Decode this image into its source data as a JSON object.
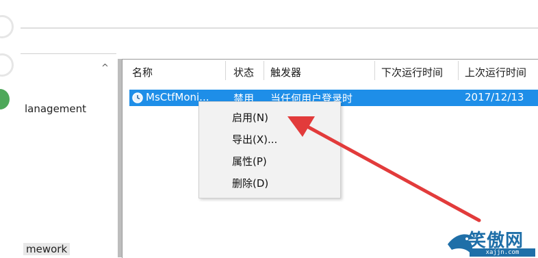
{
  "left_tree": {
    "items": [
      "lanagement",
      "mework"
    ]
  },
  "columns": [
    "名称",
    "状态",
    "触发器",
    "下次运行时间",
    "上次运行时间"
  ],
  "task": {
    "name": "MsCtfMoni...",
    "status": "禁用",
    "trigger": "当任何用户登录时",
    "next_run": "",
    "last_run": "2017/12/13"
  },
  "context_menu": {
    "items": [
      "启用(N)",
      "导出(X)...",
      "属性(P)",
      "删除(D)"
    ]
  },
  "watermark": {
    "title": "笑傲网",
    "subtitle": "xajjn.com"
  },
  "colors": {
    "selection": "#1e8ee8",
    "arrow": "#e23b3b",
    "logo": "#1f6fa8"
  }
}
